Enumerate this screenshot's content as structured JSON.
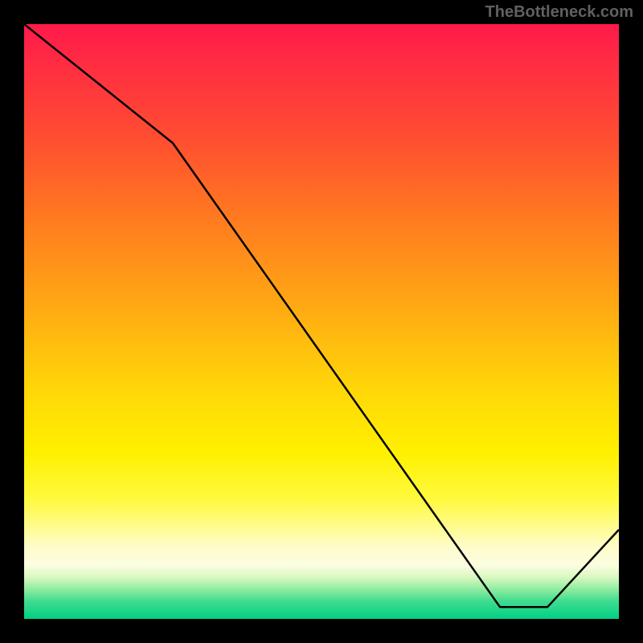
{
  "watermark": "TheBottleneck.com",
  "bottom_label": "",
  "chart_data": {
    "type": "line",
    "title": "",
    "xlabel": "",
    "ylabel": "",
    "xlim": [
      0,
      100
    ],
    "ylim": [
      0,
      100
    ],
    "series": [
      {
        "name": "curve",
        "points": [
          {
            "x": 0,
            "y": 100
          },
          {
            "x": 25,
            "y": 80
          },
          {
            "x": 80,
            "y": 2
          },
          {
            "x": 88,
            "y": 2
          },
          {
            "x": 100,
            "y": 15
          }
        ]
      }
    ],
    "gradient_stops": [
      {
        "pos": 0,
        "color": "#ff1a4a"
      },
      {
        "pos": 50,
        "color": "#ffc400"
      },
      {
        "pos": 88,
        "color": "#fffccc"
      },
      {
        "pos": 100,
        "color": "#00d084"
      }
    ]
  }
}
